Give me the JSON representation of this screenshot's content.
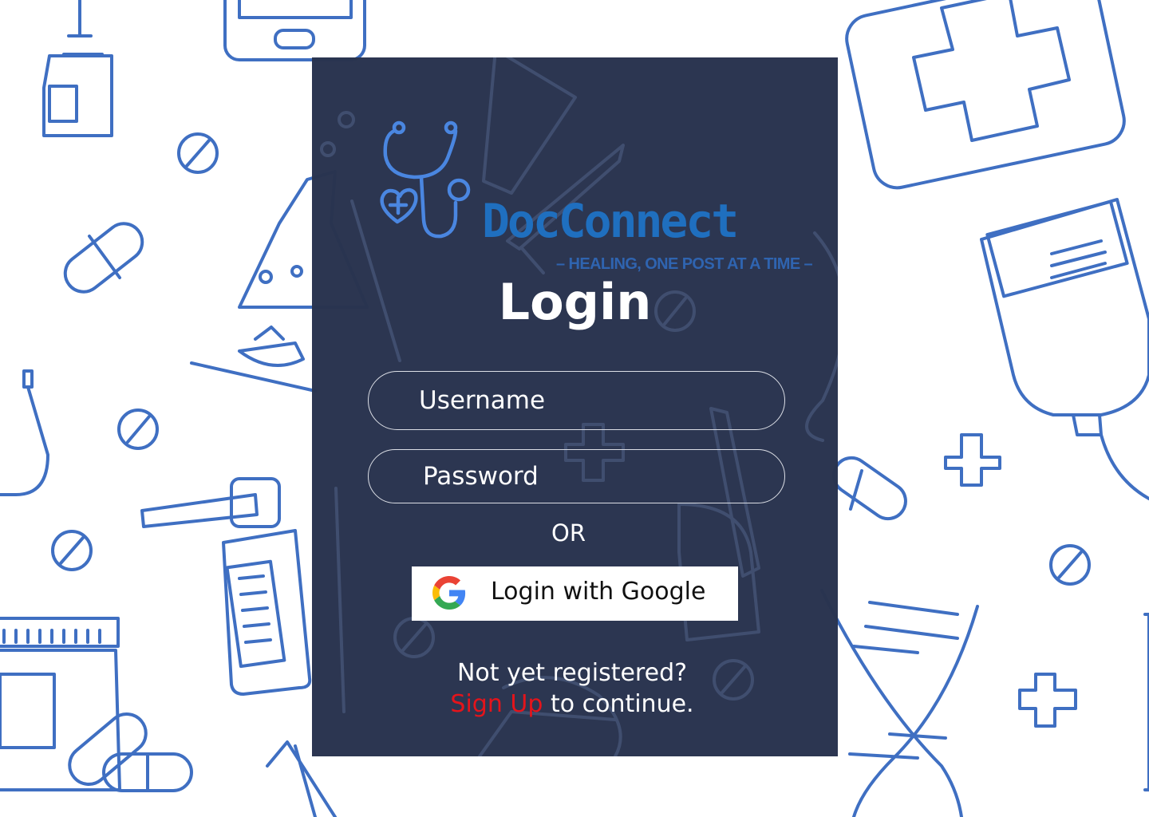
{
  "brand": {
    "name": "DocConnect",
    "tagline": "– HEALING, ONE POST AT A TIME –"
  },
  "login": {
    "title": "Login",
    "username_placeholder": "Username",
    "password_placeholder": "Password",
    "or_text": "OR",
    "google_button_label": "Login with Google",
    "register_prompt": "Not yet registered?",
    "signup_link": "Sign Up",
    "register_suffix": " to continue."
  },
  "colors": {
    "card_background": "#29334e",
    "brand_blue": "#1f6fbf",
    "pattern_blue": "#3f6fc2",
    "signup_red": "#e4141b"
  },
  "icons": {
    "logo": "stethoscope-heart-icon",
    "google": "google-g-icon"
  }
}
